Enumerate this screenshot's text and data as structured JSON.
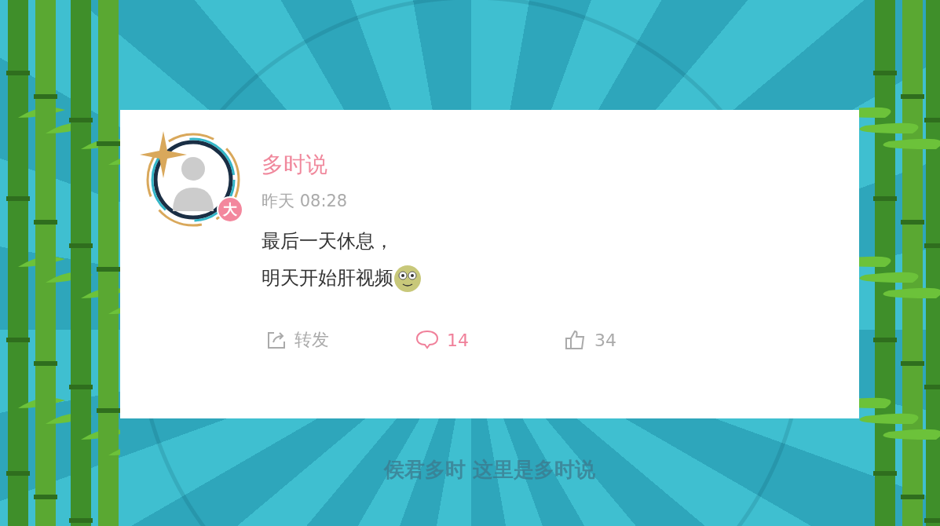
{
  "post": {
    "author": "多时说",
    "badge": "大",
    "time": "昨天 08:28",
    "lines": [
      "最后一天休息，",
      "明天开始肝视频"
    ],
    "actions": [
      {
        "kind": "share",
        "label": "转发",
        "active": false
      },
      {
        "kind": "comment",
        "label": "14",
        "active": true
      },
      {
        "kind": "like",
        "label": "34",
        "active": false
      }
    ]
  },
  "subtitle": "侯君多时 这里是多时说"
}
